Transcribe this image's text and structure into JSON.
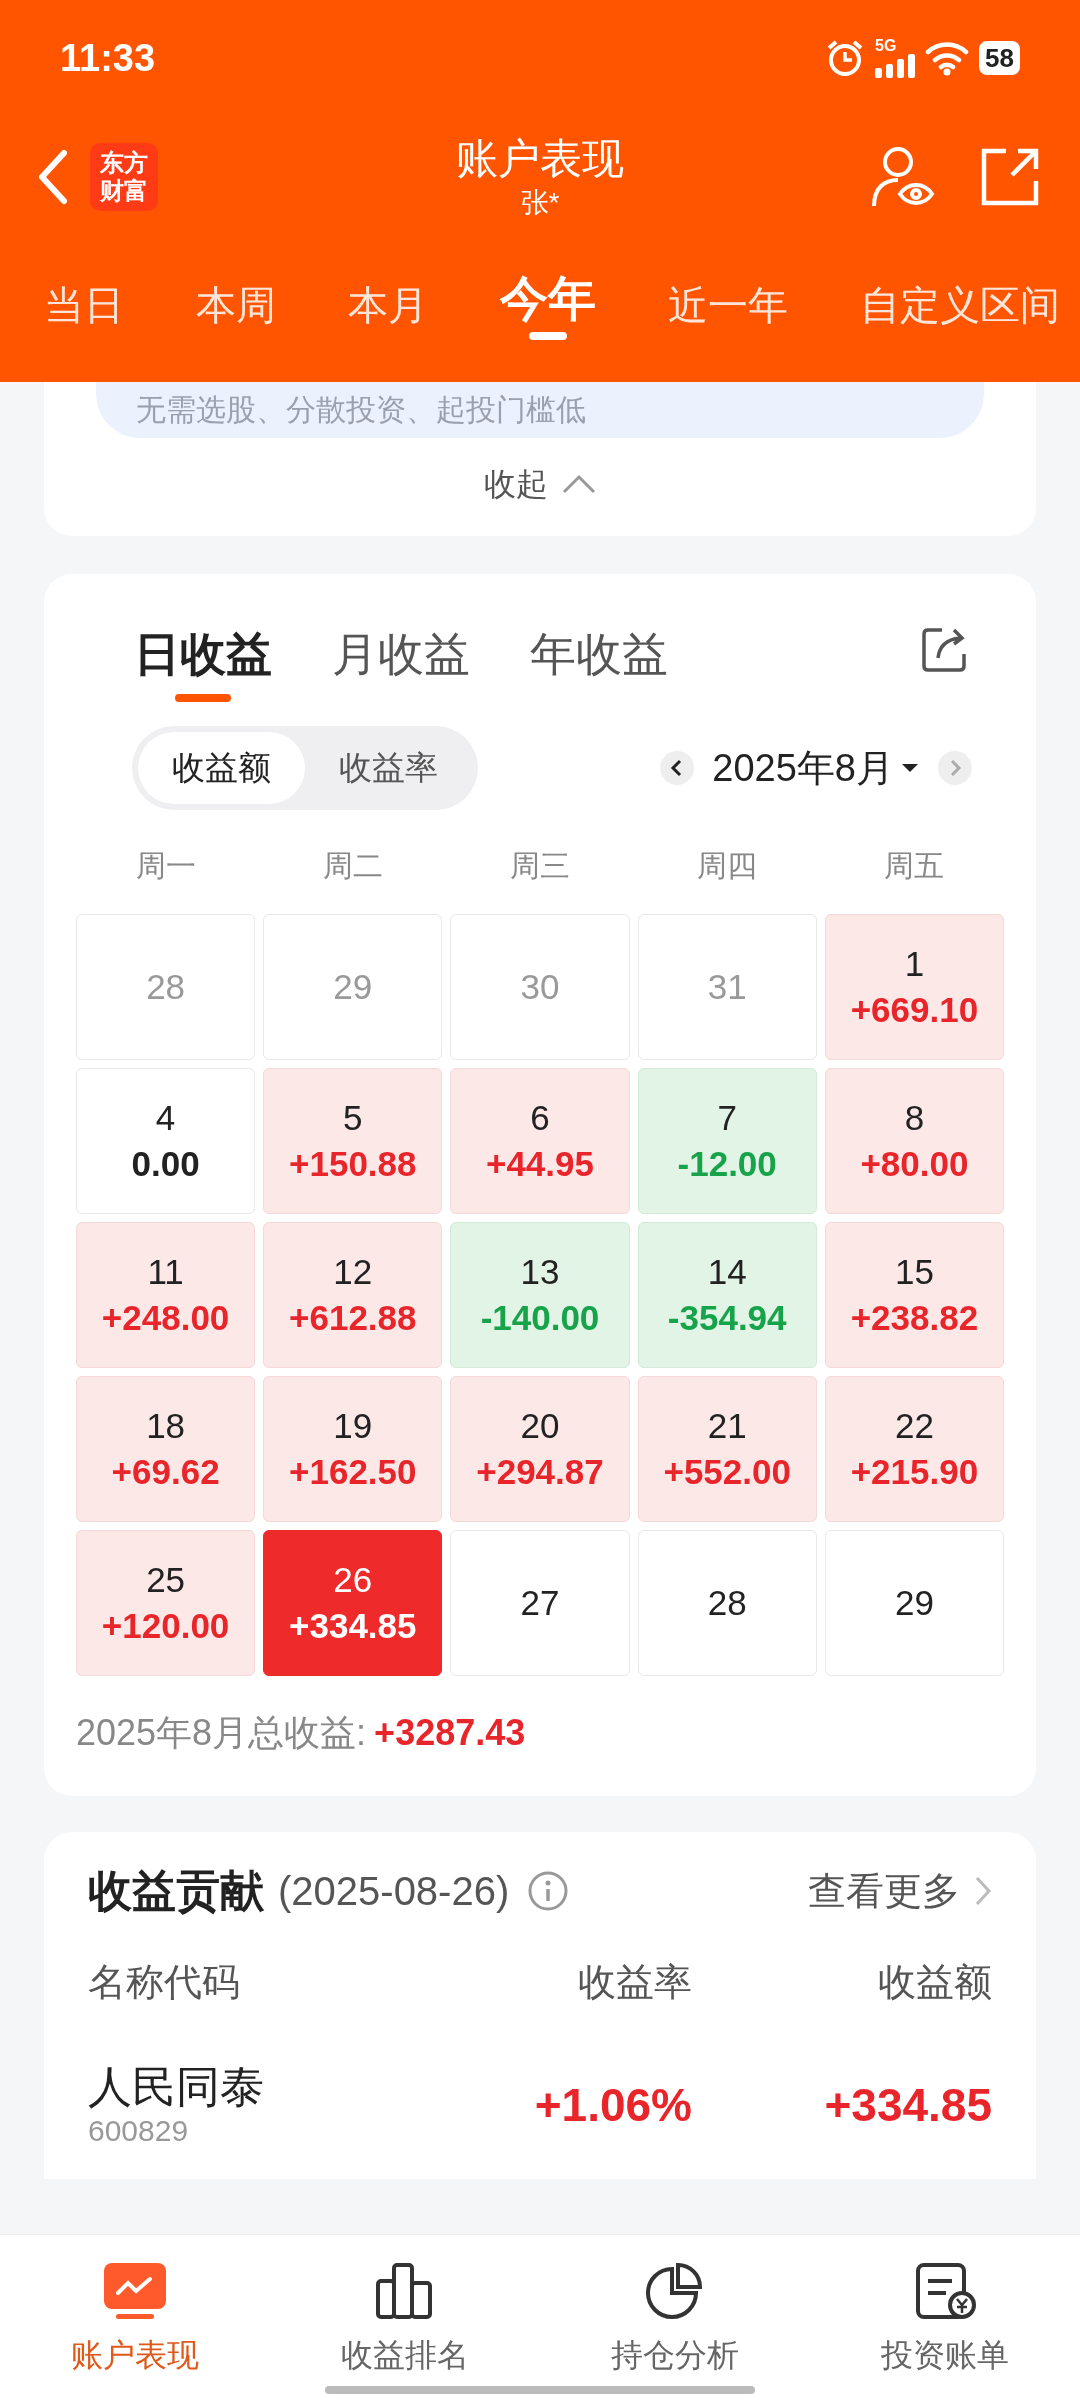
{
  "status_bar": {
    "time": "11:33",
    "network": "5G",
    "battery": "58"
  },
  "header": {
    "logo": [
      "东方",
      "财富"
    ],
    "title": "账户表现",
    "subtitle": "张*"
  },
  "period_tabs": [
    {
      "label": "当日",
      "selected": false
    },
    {
      "label": "本周",
      "selected": false
    },
    {
      "label": "本月",
      "selected": false
    },
    {
      "label": "今年",
      "selected": true
    },
    {
      "label": "近一年",
      "selected": false
    },
    {
      "label": "自定义区间",
      "selected": false
    }
  ],
  "promo_card": {
    "text": "无需选股、分散投资、起投门槛低",
    "collapse": "收起"
  },
  "earnings_card": {
    "tabs": [
      {
        "label": "日收益",
        "selected": true
      },
      {
        "label": "月收益",
        "selected": false
      },
      {
        "label": "年收益",
        "selected": false
      }
    ],
    "toggle": [
      {
        "label": "收益额",
        "selected": true
      },
      {
        "label": "收益率",
        "selected": false
      }
    ],
    "month": "2025年8月",
    "weekdays": [
      "周一",
      "周二",
      "周三",
      "周四",
      "周五"
    ],
    "days": [
      {
        "day": "28",
        "kind": "empty",
        "in_month": false,
        "selected": false
      },
      {
        "day": "29",
        "kind": "empty",
        "in_month": false,
        "selected": false
      },
      {
        "day": "30",
        "kind": "empty",
        "in_month": false,
        "selected": false
      },
      {
        "day": "31",
        "kind": "empty",
        "in_month": false,
        "selected": false
      },
      {
        "day": "1",
        "value": "+669.10",
        "kind": "up",
        "in_month": true,
        "selected": false
      },
      {
        "day": "4",
        "value": "0.00",
        "kind": "flat",
        "in_month": true,
        "selected": false
      },
      {
        "day": "5",
        "value": "+150.88",
        "kind": "up",
        "in_month": true,
        "selected": false
      },
      {
        "day": "6",
        "value": "+44.95",
        "kind": "up",
        "in_month": true,
        "selected": false
      },
      {
        "day": "7",
        "value": "-12.00",
        "kind": "down",
        "in_month": true,
        "selected": false
      },
      {
        "day": "8",
        "value": "+80.00",
        "kind": "up",
        "in_month": true,
        "selected": false
      },
      {
        "day": "11",
        "value": "+248.00",
        "kind": "up",
        "in_month": true,
        "selected": false
      },
      {
        "day": "12",
        "value": "+612.88",
        "kind": "up",
        "in_month": true,
        "selected": false
      },
      {
        "day": "13",
        "value": "-140.00",
        "kind": "down",
        "in_month": true,
        "selected": false
      },
      {
        "day": "14",
        "value": "-354.94",
        "kind": "down",
        "in_month": true,
        "selected": false
      },
      {
        "day": "15",
        "value": "+238.82",
        "kind": "up",
        "in_month": true,
        "selected": false
      },
      {
        "day": "18",
        "value": "+69.62",
        "kind": "up",
        "in_month": true,
        "selected": false
      },
      {
        "day": "19",
        "value": "+162.50",
        "kind": "up",
        "in_month": true,
        "selected": false
      },
      {
        "day": "20",
        "value": "+294.87",
        "kind": "up",
        "in_month": true,
        "selected": false
      },
      {
        "day": "21",
        "value": "+552.00",
        "kind": "up",
        "in_month": true,
        "selected": false
      },
      {
        "day": "22",
        "value": "+215.90",
        "kind": "up",
        "in_month": true,
        "selected": false
      },
      {
        "day": "25",
        "value": "+120.00",
        "kind": "up",
        "in_month": true,
        "selected": false
      },
      {
        "day": "26",
        "value": "+334.85",
        "kind": "up",
        "in_month": true,
        "selected": true
      },
      {
        "day": "27",
        "kind": "empty",
        "in_month": true,
        "selected": false
      },
      {
        "day": "28",
        "kind": "empty",
        "in_month": true,
        "selected": false
      },
      {
        "day": "29",
        "kind": "empty",
        "in_month": true,
        "selected": false
      }
    ],
    "total_label": "2025年8月总收益:",
    "total_value": "+3287.43"
  },
  "contribution": {
    "title": "收益贡献",
    "date": "(2025-08-26)",
    "more": "查看更多",
    "columns": [
      "名称代码",
      "收益率",
      "收益额"
    ],
    "rows": [
      {
        "name": "人民同泰",
        "code": "600829",
        "rate": "+1.06%",
        "amount": "+334.85"
      }
    ]
  },
  "bottom_nav": [
    {
      "label": "账户表现",
      "selected": true
    },
    {
      "label": "收益排名",
      "selected": false
    },
    {
      "label": "持仓分析",
      "selected": false
    },
    {
      "label": "投资账单",
      "selected": false
    }
  ]
}
